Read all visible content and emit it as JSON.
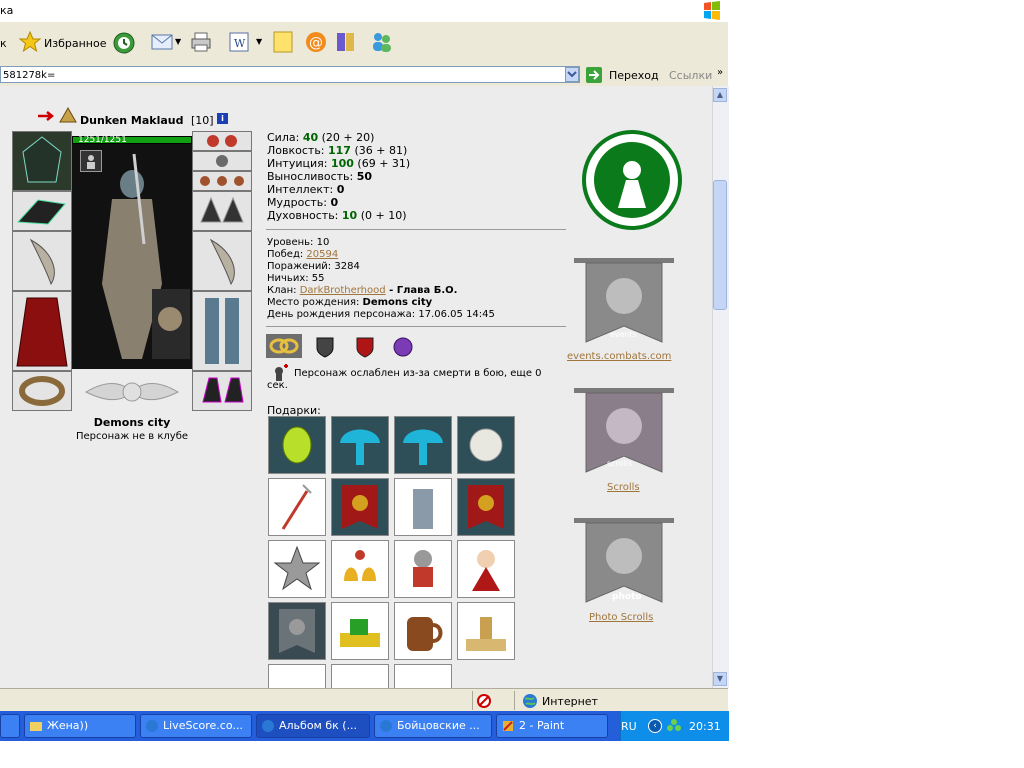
{
  "window": {
    "title_fragment": "ка"
  },
  "toolbar": {
    "back_fragment": "к",
    "favorites_label": "Избранное"
  },
  "address": {
    "url_fragment": "581278k=",
    "go_label": "Переход",
    "links_label": "Ссылки"
  },
  "character": {
    "name": "Dunken Maklaud",
    "level_badge": "[10]",
    "hp": "1251/1251",
    "city": "Demons city",
    "club_status": "Персонаж не в клубе"
  },
  "stats": [
    {
      "label": "Сила: ",
      "value": "40",
      "extra": " (20 + 20)"
    },
    {
      "label": "Ловкость: ",
      "value": "117",
      "extra": " (36 + 81)"
    },
    {
      "label": "Интуиция: ",
      "value": "100",
      "extra": " (69 + 31)"
    },
    {
      "label": "Выносливость: ",
      "value": "50",
      "extra": ""
    },
    {
      "label": "Интеллект: ",
      "value": "0",
      "extra": ""
    },
    {
      "label": "Мудрость: ",
      "value": "0",
      "extra": ""
    },
    {
      "label": "Духовность: ",
      "value": "10",
      "extra": " (0 + 10)"
    }
  ],
  "info": {
    "level_label": "Уровень: ",
    "level": "10",
    "wins_label": "Побед: ",
    "wins": "20594",
    "losses_label": "Поражений: ",
    "losses": "3284",
    "draws_label": "Ничьих: ",
    "draws": "55",
    "clan_label": "Клан: ",
    "clan": "DarkBrotherhood",
    "clan_rank": " - Глава Б.О.",
    "birthplace_label": "Место рождения: ",
    "birthplace": "Demons city",
    "birthday_label": "День рождения персонажа: ",
    "birthday": "17.06.05 14:45"
  },
  "notice": {
    "line1": "Персонаж ослаблен из-за смерти в бою, еще 0",
    "line2": "сек."
  },
  "gifts": {
    "label": "Подарки:"
  },
  "side_links": {
    "events_text": "events",
    "events": "events.combats.com",
    "scrolls_text": "scrolls",
    "scrolls": "Scrolls",
    "photo_text": "photo",
    "photo": "Photo Scrolls"
  },
  "statusbar": {
    "zone": "Интернет"
  },
  "taskbar": {
    "items": [
      "Жена))",
      "LiveScore.co...",
      "Альбом бк (...",
      "Бойцовские ...",
      "2 - Paint"
    ],
    "lang": "RU",
    "clock": "20:31"
  },
  "colors": {
    "accent_green": "#006400",
    "link": "#a0753a",
    "taskbar": "#245edb"
  }
}
